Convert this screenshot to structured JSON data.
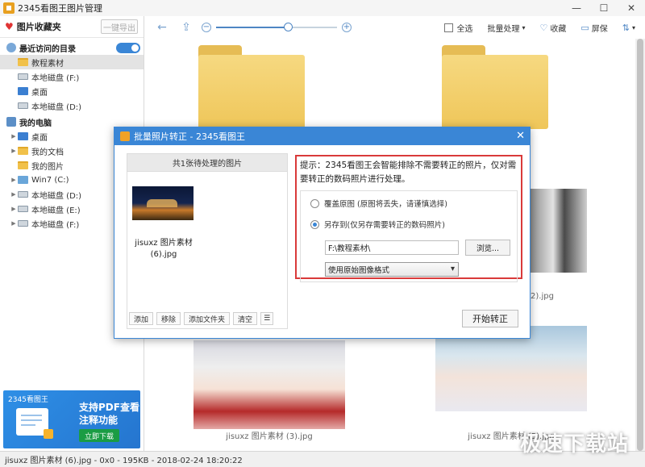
{
  "window": {
    "title": "2345看图王图片管理"
  },
  "sidebar": {
    "favorites_label": "图片收藏夹",
    "export_label": "一键导出",
    "recent_label": "最近访问的目录",
    "recent_items": [
      "教程素材",
      "本地磁盘 (F:)",
      "桌面",
      "本地磁盘 (D:)"
    ],
    "pc_label": "我的电脑",
    "pc_items": [
      "桌面",
      "我的文档",
      "我的图片",
      "Win7 (C:)",
      "本地磁盘 (D:)",
      "本地磁盘 (E:)",
      "本地磁盘 (F:)"
    ]
  },
  "ad": {
    "brand": "2345看图王",
    "line1": "支持PDF查看",
    "line2": "注释功能",
    "cta": "立即下载"
  },
  "toolbar": {
    "select_all": "全选",
    "batch": "批量处理",
    "favorite": "收藏",
    "screen": "屏保",
    "zoom_level": 0.6
  },
  "grid": {
    "captions": [
      "2).jpg",
      "jisuxz 图片素材 (3).jpg",
      "jisuxz 图片素材 (5).jpg"
    ]
  },
  "status": {
    "text": "jisuxz 图片素材 (6).jpg - 0x0 - 195KB - 2018-02-24 18:20:22",
    "watermark": "极速下载站"
  },
  "dialog": {
    "title": "批量照片转正 - 2345看图王",
    "list_header": "共1张待处理的图片",
    "item_name_1": "jisuxz 图片素材",
    "item_name_2": "(6).jpg",
    "buttons": [
      "添加",
      "移除",
      "添加文件夹",
      "清空"
    ],
    "hint": "提示：2345看图王会智能排除不需要转正的照片，仅对需要转正的数码照片进行处理。",
    "option_overwrite": "覆盖原图 (原图将丢失，请谨慎选择)",
    "option_saveas": "另存到(仅另存需要转正的数码照片)",
    "path": "F:\\教程素材\\",
    "browse": "浏览...",
    "format": "使用原始图像格式",
    "start": "开始转正"
  }
}
